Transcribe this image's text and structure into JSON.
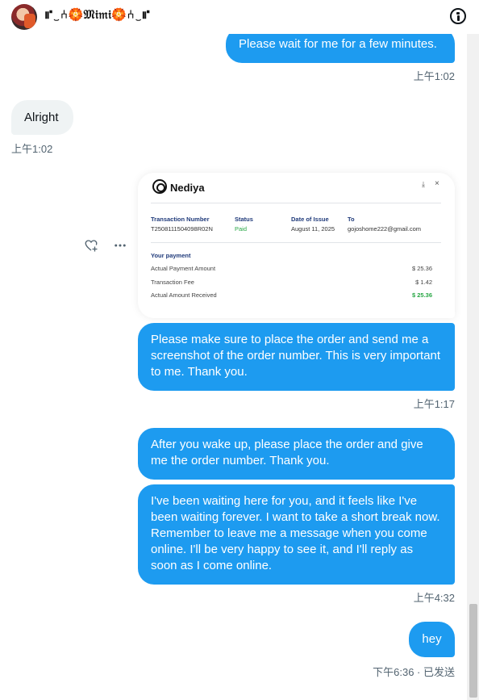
{
  "header": {
    "title": "⑈‿⑃🏵️𝔐𝔦𝔪𝔦🏵️⑃‿⑈"
  },
  "messages": [
    {
      "text": "Please wait for me for a few minutes.",
      "time": "上午1:02"
    },
    {
      "text": "Alright",
      "time": "上午1:02"
    },
    {
      "text": "Please make sure to place the order and send me a screenshot of the order number. This is very important to me. Thank you.",
      "time": "上午1:17"
    },
    {
      "text": "After you wake up, please place the order and give me the order number. Thank you."
    },
    {
      "text": "I've been waiting here for you, and it feels like I've been waiting forever. I want to take a short break now. Remember to leave me a message when you come online. I'll be very happy to see it, and I'll reply as soon as I come online.",
      "time": "上午4:32"
    },
    {
      "text": "hey",
      "time": "下午6:36 · 已发送"
    }
  ],
  "receipt": {
    "brand": "Nediya",
    "download": "⤓",
    "close": "×",
    "headers": [
      "Transaction Number",
      "Status",
      "Date of Issue",
      "To"
    ],
    "values": [
      "T2508111504098R02N",
      "Paid",
      "August 11, 2025",
      "gojoshome222@gmail.com"
    ],
    "section": "Your payment",
    "rows": [
      {
        "label": "Actual Payment Amount",
        "amount": "$ 25.36"
      },
      {
        "label": "Transaction Fee",
        "amount": "$ 1.42"
      },
      {
        "label": "Actual Amount Received",
        "amount": "$ 25.36"
      }
    ]
  },
  "icons": {
    "info": "info-icon",
    "react": "heart-plus-icon",
    "more": "more-horizontal-icon"
  },
  "colors": {
    "outgoing_bubble": "#1d9bf0",
    "incoming_bubble": "#eff3f4",
    "timestamp": "#536471",
    "paid": "#28a745"
  }
}
